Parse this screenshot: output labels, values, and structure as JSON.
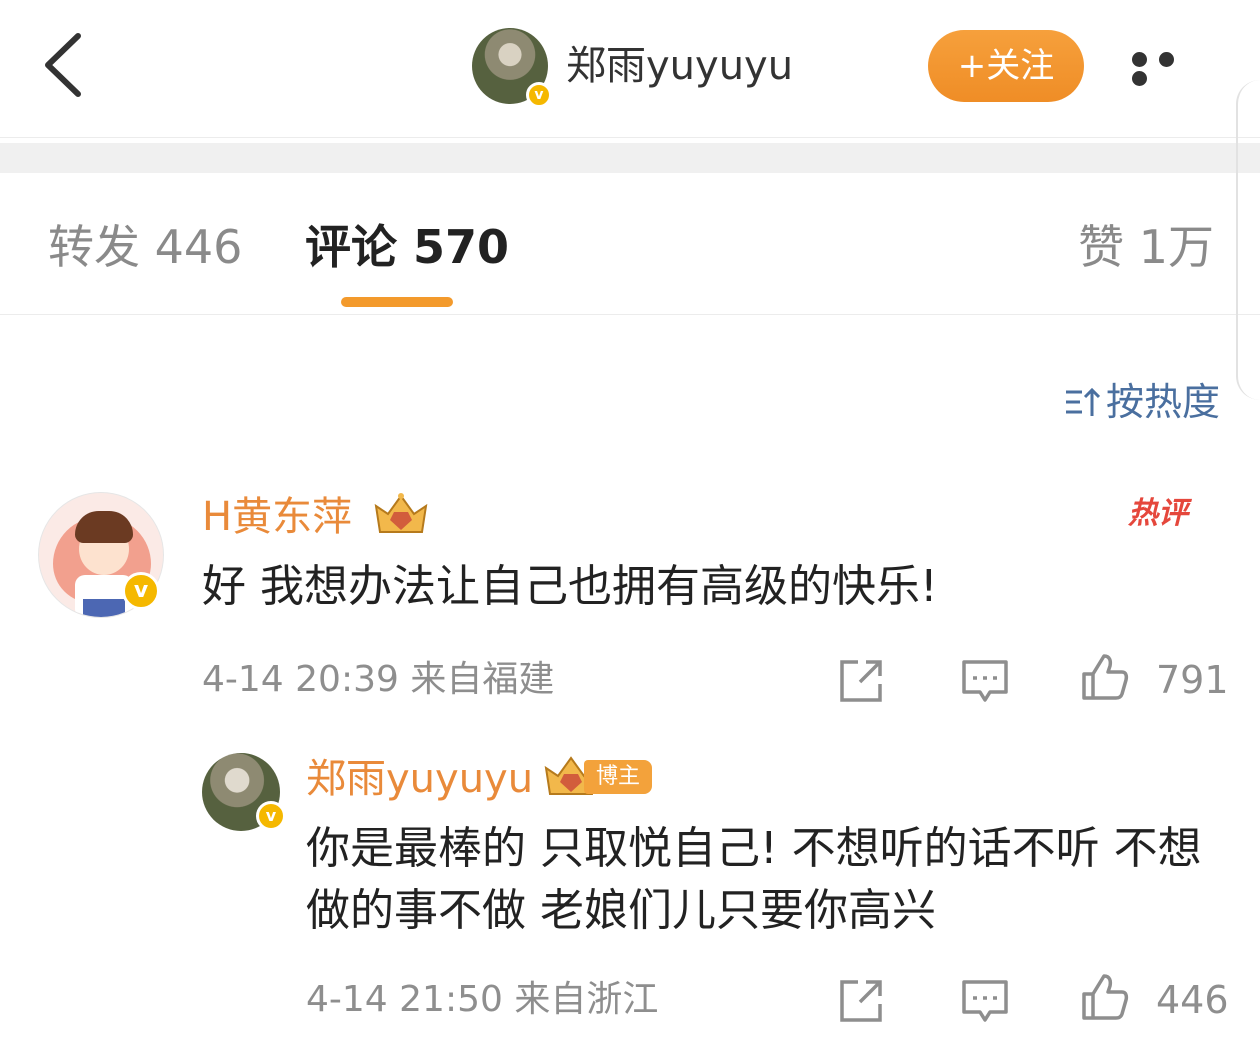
{
  "header": {
    "username": "郑雨yuyuyu",
    "follow_label": "+关注"
  },
  "tabs": {
    "repost": "转发 446",
    "comment": "评论 570",
    "like": "赞 1万"
  },
  "sort": {
    "label": "按热度"
  },
  "comments": [
    {
      "user": "H黄东萍",
      "hot_tag": "热评",
      "text": "好 我想办法让自己也拥有高级的快乐!",
      "meta": "4-14 20:39 来自福建",
      "likes": "791"
    },
    {
      "user": "郑雨yuyuyu",
      "badge": "博主",
      "text": "你是最棒的 只取悦自己! 不想听的话不听 不想做的事不做 老娘们儿只要你高兴",
      "meta": "4-14 21:50 来自浙江",
      "likes": "446"
    }
  ],
  "colors": {
    "accent": "#f39a2c",
    "username": "#e98a3a",
    "sort": "#4a6f9f",
    "hot": "#e5473c"
  }
}
